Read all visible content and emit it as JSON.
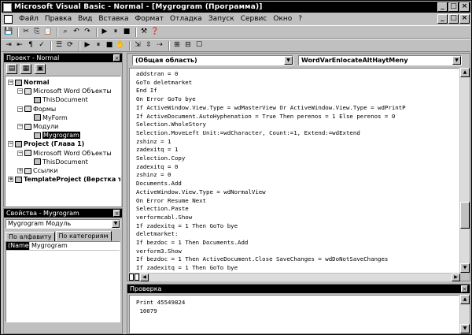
{
  "window": {
    "title": "Microsoft Visual Basic - Normal - [Mygrogram (Программа)]",
    "min": "_",
    "max": "□",
    "close": "×"
  },
  "menu": [
    "Файл",
    "Правка",
    "Вид",
    "Вставка",
    "Формат",
    "Отладка",
    "Запуск",
    "Сервис",
    "Окно",
    "?"
  ],
  "toolbar1": [
    "💾",
    "✂",
    "⎘",
    "📋",
    "⌕",
    "↶",
    "↷",
    "▶",
    "⏸",
    "■",
    "⚒",
    "❓"
  ],
  "toolbar2": [
    "⇥",
    "⇤",
    "¶",
    "✓",
    "☰",
    "⟳",
    "▶",
    "⏸",
    "■",
    "✋",
    "⇲",
    "⇳",
    "⇢",
    "⊞",
    "⊟",
    "☐"
  ],
  "project": {
    "title": "Проект - Normal",
    "nodes": [
      {
        "label": "Normal",
        "indent": 0,
        "bold": true,
        "exp": "−"
      },
      {
        "label": "Microsoft Word Объекты",
        "indent": 1,
        "bold": false,
        "exp": "−",
        "folder": true
      },
      {
        "label": "ThisDocument",
        "indent": 2,
        "bold": false,
        "exp": ""
      },
      {
        "label": "Формы",
        "indent": 1,
        "bold": false,
        "exp": "−",
        "folder": true
      },
      {
        "label": "MyForm",
        "indent": 2,
        "bold": false,
        "exp": ""
      },
      {
        "label": "Модули",
        "indent": 1,
        "bold": false,
        "exp": "−",
        "folder": true
      },
      {
        "label": "Mygrogram",
        "indent": 2,
        "bold": false,
        "exp": "",
        "selected": true
      },
      {
        "label": "Project (Глава 1)",
        "indent": 0,
        "bold": true,
        "exp": "−"
      },
      {
        "label": "Microsoft Word Объекты",
        "indent": 1,
        "bold": false,
        "exp": "−",
        "folder": true
      },
      {
        "label": "ThisDocument",
        "indent": 2,
        "bold": false,
        "exp": ""
      },
      {
        "label": "Ссылки",
        "indent": 1,
        "bold": false,
        "exp": "+",
        "folder": true
      },
      {
        "label": "TemplateProject (Верстка текст",
        "indent": 0,
        "bold": true,
        "exp": "+"
      }
    ]
  },
  "properties": {
    "title": "Свойства - Mygrogram",
    "combo": "Mygrogram Модуль",
    "tab_alpha": "По алфавиту",
    "tab_category": "По категориям",
    "prop_name": "(Name)",
    "prop_value": "Mygrogram"
  },
  "code": {
    "left_combo": "(Общая область)",
    "right_combo": "WordVarEnlocateAltHaytMeny",
    "lines": [
      "addstran = 0",
      "GoTo deletmarket",
      "End If",
      "On Error GoTo bye",
      "If ActiveWindow.View.Type = wdMasterView Or ActiveWindow.View.Type = wdPrintP",
      "If ActiveDocument.AutoHyphenation = True Then perenos = 1 Else perenos = 0",
      "Selection.WholeStory",
      "Selection.MoveLeft Unit:=wdCharacter, Count:=1, Extend:=wdExtend",
      "zshinz = 1",
      "zadexitq = 1",
      "Selection.Copy",
      "zadexitq = 0",
      "zshinz = 0",
      "Documents.Add",
      "ActiveWindow.View.Type = wdNormalView",
      "On Error Resume Next",
      "Selection.Paste",
      "verformcabl.Show",
      "If zadexitq = 1 Then GoTo bye",
      "deletmarket:",
      "If bezdoc = 1 Then Documents.Add",
      "verform3.Show",
      "If bezdoc = 1 Then ActiveDocument.Close SaveChanges = wdDoNotSaveChanges",
      "If zadexitq = 1 Then GoTo bye"
    ]
  },
  "immediate": {
    "title": "Проверка",
    "lines": [
      "Print 45549824",
      " 10079"
    ]
  }
}
